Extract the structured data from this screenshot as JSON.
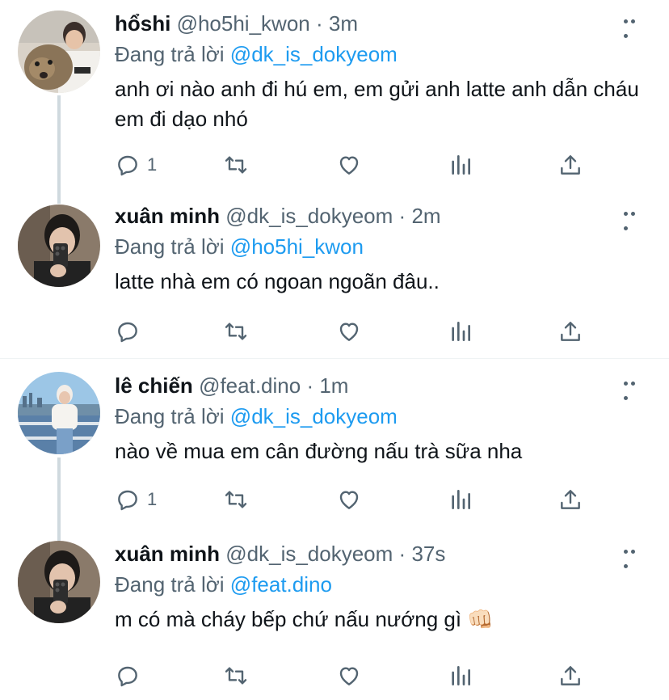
{
  "tweets": [
    {
      "name": "hổshi",
      "handle": "@ho5hi_kwon",
      "dot": "·",
      "time": "3m",
      "replying_label": "Đang trả lời",
      "replying_to": "@dk_is_dokyeom",
      "text": "anh ơi nào anh đi hú em, em gửi anh latte anh dẫn cháu em đi dạo nhó",
      "reply_count": "1"
    },
    {
      "name": "xuân minh",
      "handle": "@dk_is_dokyeom",
      "dot": "·",
      "time": "2m",
      "replying_label": "Đang trả lời",
      "replying_to": "@ho5hi_kwon",
      "text": "latte nhà em có ngoan ngoãn đâu..",
      "reply_count": ""
    },
    {
      "name": "lê chiến",
      "handle": "@feat.dino",
      "dot": "·",
      "time": "1m",
      "replying_label": "Đang trả lời",
      "replying_to": "@dk_is_dokyeom",
      "text": "nào về mua em cân đường nấu trà sữa nha",
      "reply_count": "1"
    },
    {
      "name": "xuân minh",
      "handle": "@dk_is_dokyeom",
      "dot": "·",
      "time": "37s",
      "replying_label": "Đang trả lời",
      "replying_to": "@feat.dino",
      "text": "m có mà cháy bếp chứ nấu nướng gì 👊🏻",
      "reply_count": ""
    }
  ],
  "colors": {
    "link": "#1d9bf0",
    "secondary": "#536471",
    "primary_text": "#0f1419",
    "thread_line": "#cfd9de"
  },
  "icons": [
    "more-icon",
    "reply-icon",
    "retweet-icon",
    "like-icon",
    "analytics-icon",
    "share-icon"
  ]
}
